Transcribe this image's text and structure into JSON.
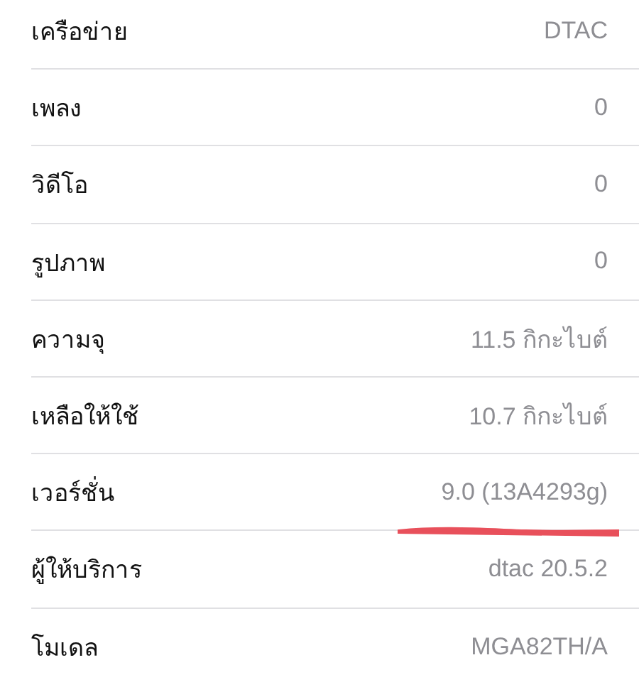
{
  "rows": [
    {
      "label": "เครือข่าย",
      "value": "DTAC",
      "underlined": false
    },
    {
      "label": "เพลง",
      "value": "0",
      "underlined": false
    },
    {
      "label": "วิดีโอ",
      "value": "0",
      "underlined": false
    },
    {
      "label": "รูปภาพ",
      "value": "0",
      "underlined": false
    },
    {
      "label": "ความจุ",
      "value": "11.5 กิกะไบต์",
      "underlined": false
    },
    {
      "label": "เหลือให้ใช้",
      "value": "10.7 กิกะไบต์",
      "underlined": false
    },
    {
      "label": "เวอร์ชั่น",
      "value": "9.0 (13A4293g)",
      "underlined": true
    },
    {
      "label": "ผู้ให้บริการ",
      "value": "dtac 20.5.2",
      "underlined": false
    },
    {
      "label": "โมเดล",
      "value": "MGA82TH/A",
      "underlined": false
    }
  ]
}
